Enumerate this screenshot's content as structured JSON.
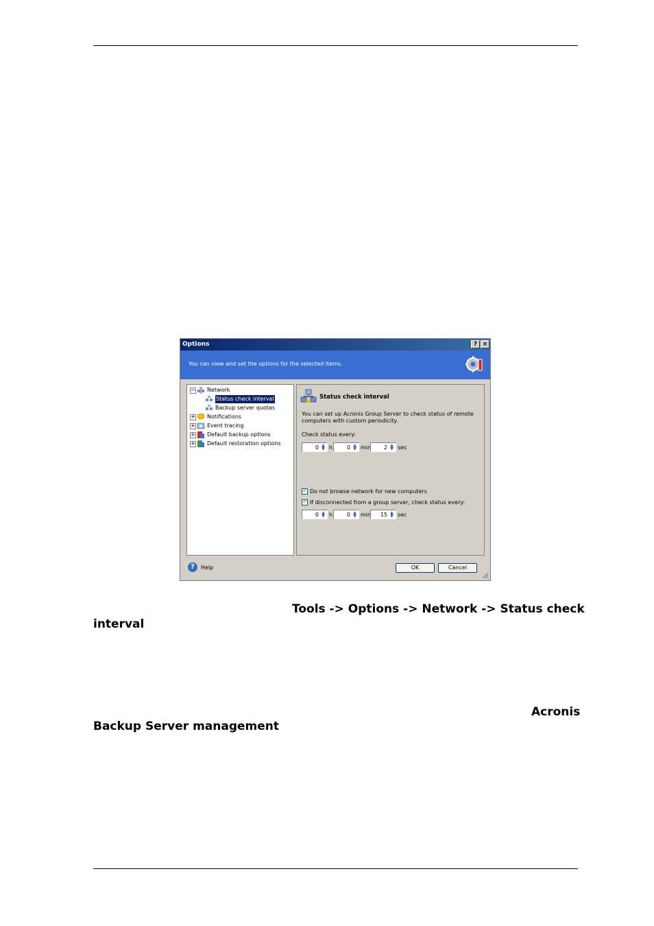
{
  "page": {
    "caption_line1": "Tools -> Options -> Network -> Status check",
    "caption_line2": "interval",
    "para2_line1": "Acronis",
    "para2_line2": "Backup Server management"
  },
  "dialog": {
    "title": "Options",
    "help_button": "?",
    "close_button": "×",
    "banner_text": "You can view and set the options for the selected items.",
    "tree": {
      "network": "Network",
      "status_check_interval": "Status check interval",
      "backup_server_quotas": "Backup server quotas",
      "notifications": "Notifications",
      "event_tracing": "Event tracing",
      "default_backup_options": "Default backup options",
      "default_restoration_options": "Default restoration options"
    },
    "panel": {
      "heading": "Status check interval",
      "description": "You can set up Acronis Group Server to check status of remote computers with custom periodicity.",
      "check_label": "Check status every:",
      "interval1": {
        "h": "0",
        "min": "0",
        "sec": "2"
      },
      "units": {
        "h": "h",
        "min": "min",
        "sec": "sec"
      },
      "checkbox1_label": "Do not browse network for new computers",
      "checkbox1_checked": true,
      "checkbox2_label": "If disconnected from a group server, check status every:",
      "checkbox2_checked": true,
      "interval2": {
        "h": "0",
        "min": "0",
        "sec": "15"
      }
    },
    "footer": {
      "help_label": "Help",
      "ok_label": "OK",
      "cancel_label": "Cancel"
    }
  }
}
